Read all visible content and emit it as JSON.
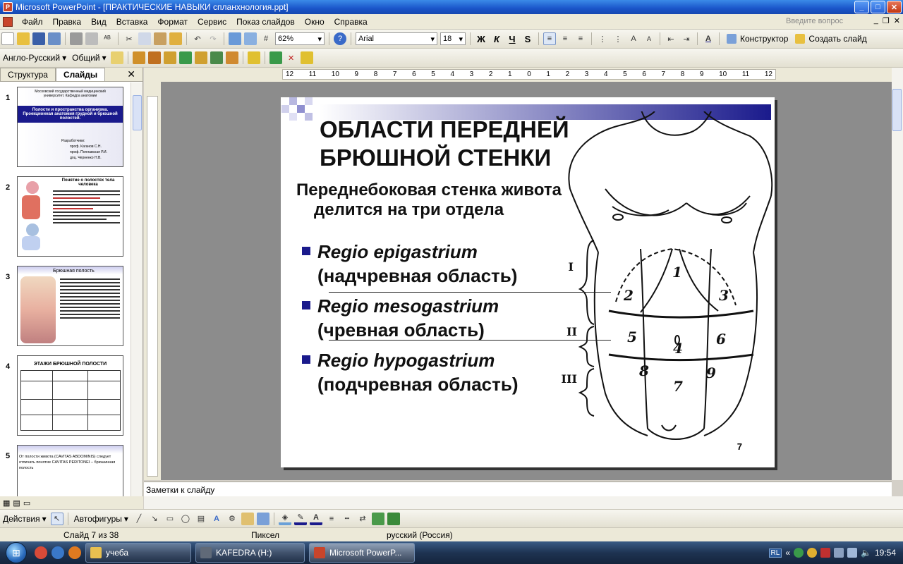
{
  "window": {
    "title": "Microsoft PowerPoint - [ПРАКТИЧЕСКИЕ НАВЫКИ спланхнология.ppt]"
  },
  "menu": {
    "items": [
      "Файл",
      "Правка",
      "Вид",
      "Вставка",
      "Формат",
      "Сервис",
      "Показ слайдов",
      "Окно",
      "Справка"
    ],
    "help_placeholder": "Введите вопрос"
  },
  "toolbar": {
    "zoom": "62%",
    "font": "Arial",
    "font_size": "18",
    "bold": "Ж",
    "italic": "К",
    "underline": "Ч",
    "shadow": "S",
    "constructor": "Конструктор",
    "new_slide": "Создать слайд",
    "translate_dir": "Англо-Русский",
    "common": "Общий"
  },
  "panel": {
    "tab_outline": "Структура",
    "tab_slides": "Слайды",
    "thumbnails": [
      {
        "num": "1",
        "title": "Полости и пространства организма. Проекционная анатомия грудной и брюшной полостей.",
        "header": "Московский государственный медицинский университет. Кафедра анатомии",
        "credits": [
          "Разработчики:",
          "проф. Каганов С.Н.",
          "проф. Поплавская Р.И.",
          "доц. Черненко Н.В."
        ]
      },
      {
        "num": "2",
        "title": "Понятие о полостях тела человека"
      },
      {
        "num": "3",
        "title": "Брюшная полость"
      },
      {
        "num": "4",
        "title": "ЭТАЖИ БРЮШНОЙ ПОЛОСТИ"
      },
      {
        "num": "5",
        "title": "От полости живота (CAVITAS ABDOMINIS) следует отличать понятие CAVITAS PERITONEI – брюшинная полость"
      }
    ]
  },
  "ruler": {
    "h_labels": [
      "12",
      "11",
      "10",
      "9",
      "8",
      "7",
      "6",
      "5",
      "4",
      "3",
      "2",
      "1",
      "0",
      "1",
      "2",
      "3",
      "4",
      "5",
      "6",
      "7",
      "8",
      "9",
      "10",
      "11",
      "12"
    ]
  },
  "slide": {
    "title_line1": "ОБЛАСТИ ПЕРЕДНЕЙ",
    "title_line2": "БРЮШНОЙ СТЕНКИ",
    "subtitle_line1": "Переднебоковая стенка живота",
    "subtitle_line2": "делится на три отдела",
    "bullets": [
      {
        "latin": "Regio epigastrium",
        "russian": "(надчревная область)"
      },
      {
        "latin": "Regio mesogastrium",
        "russian": "(чревная область)"
      },
      {
        "latin": "Regio hypogastrium",
        "russian": "(подчревная область)"
      }
    ],
    "roman": [
      "I",
      "II",
      "III"
    ],
    "region_numbers": [
      "1",
      "2",
      "3",
      "4",
      "5",
      "6",
      "7",
      "8",
      "9"
    ],
    "page_number": "7"
  },
  "notes": {
    "placeholder": "Заметки к слайду"
  },
  "drawing": {
    "actions": "Действия",
    "autoshapes": "Автофигуры"
  },
  "status": {
    "slide_info": "Слайд 7 из 38",
    "design": "Пиксел",
    "language": "русский (Россия)"
  },
  "taskbar": {
    "tasks": [
      {
        "label": "учеба"
      },
      {
        "label": "KAFEDRA (H:)"
      },
      {
        "label": "Microsoft PowerP..."
      }
    ],
    "lang": "RL",
    "time": "19:54"
  },
  "colors": {
    "accent": "#1a1a8c",
    "titlebar": "#1a55c9",
    "canvas": "#8c8c8c"
  }
}
